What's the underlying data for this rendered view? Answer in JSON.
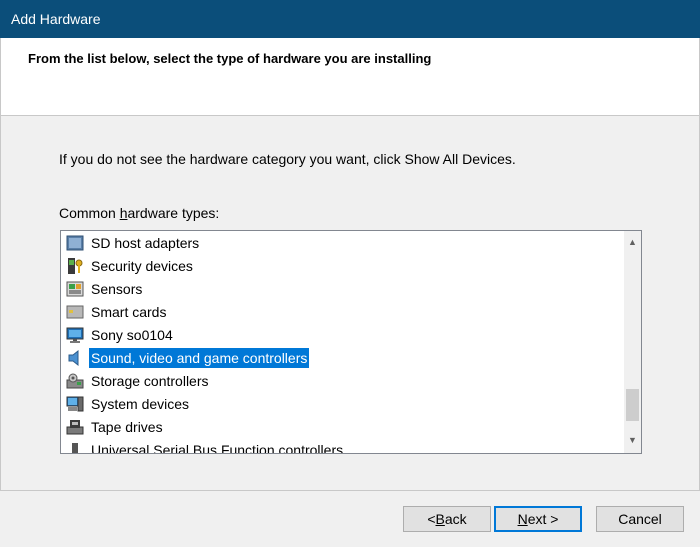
{
  "window": {
    "title": "Add Hardware"
  },
  "header": {
    "heading": "From the list below, select the type of hardware you are installing"
  },
  "instruction": "If you do not see the hardware category you want, click Show All Devices.",
  "list": {
    "label_prefix": "Common ",
    "label_accel": "h",
    "label_suffix": "ardware types:",
    "items": [
      {
        "label": "SD host adapters",
        "icon": "sd-host-adapter-icon"
      },
      {
        "label": "Security devices",
        "icon": "security-device-icon"
      },
      {
        "label": "Sensors",
        "icon": "sensor-icon"
      },
      {
        "label": "Smart cards",
        "icon": "smart-card-icon"
      },
      {
        "label": "Sony so0104",
        "icon": "monitor-icon"
      },
      {
        "label": "Sound, video and game controllers",
        "icon": "speaker-icon",
        "selected": true
      },
      {
        "label": "Storage controllers",
        "icon": "storage-controller-icon"
      },
      {
        "label": "System devices",
        "icon": "system-device-icon"
      },
      {
        "label": "Tape drives",
        "icon": "tape-drive-icon"
      },
      {
        "label": "Universal Serial Bus Function controllers",
        "icon": "usb-icon"
      }
    ],
    "scroll_up_glyph": "▲",
    "scroll_down_glyph": "▼"
  },
  "buttons": {
    "back_prefix": "< ",
    "back_accel": "B",
    "back_suffix": "ack",
    "next_accel": "N",
    "next_suffix": "ext >",
    "cancel": "Cancel"
  },
  "colors": {
    "titlebar": "#0b4e7a",
    "selection": "#0078d7"
  }
}
